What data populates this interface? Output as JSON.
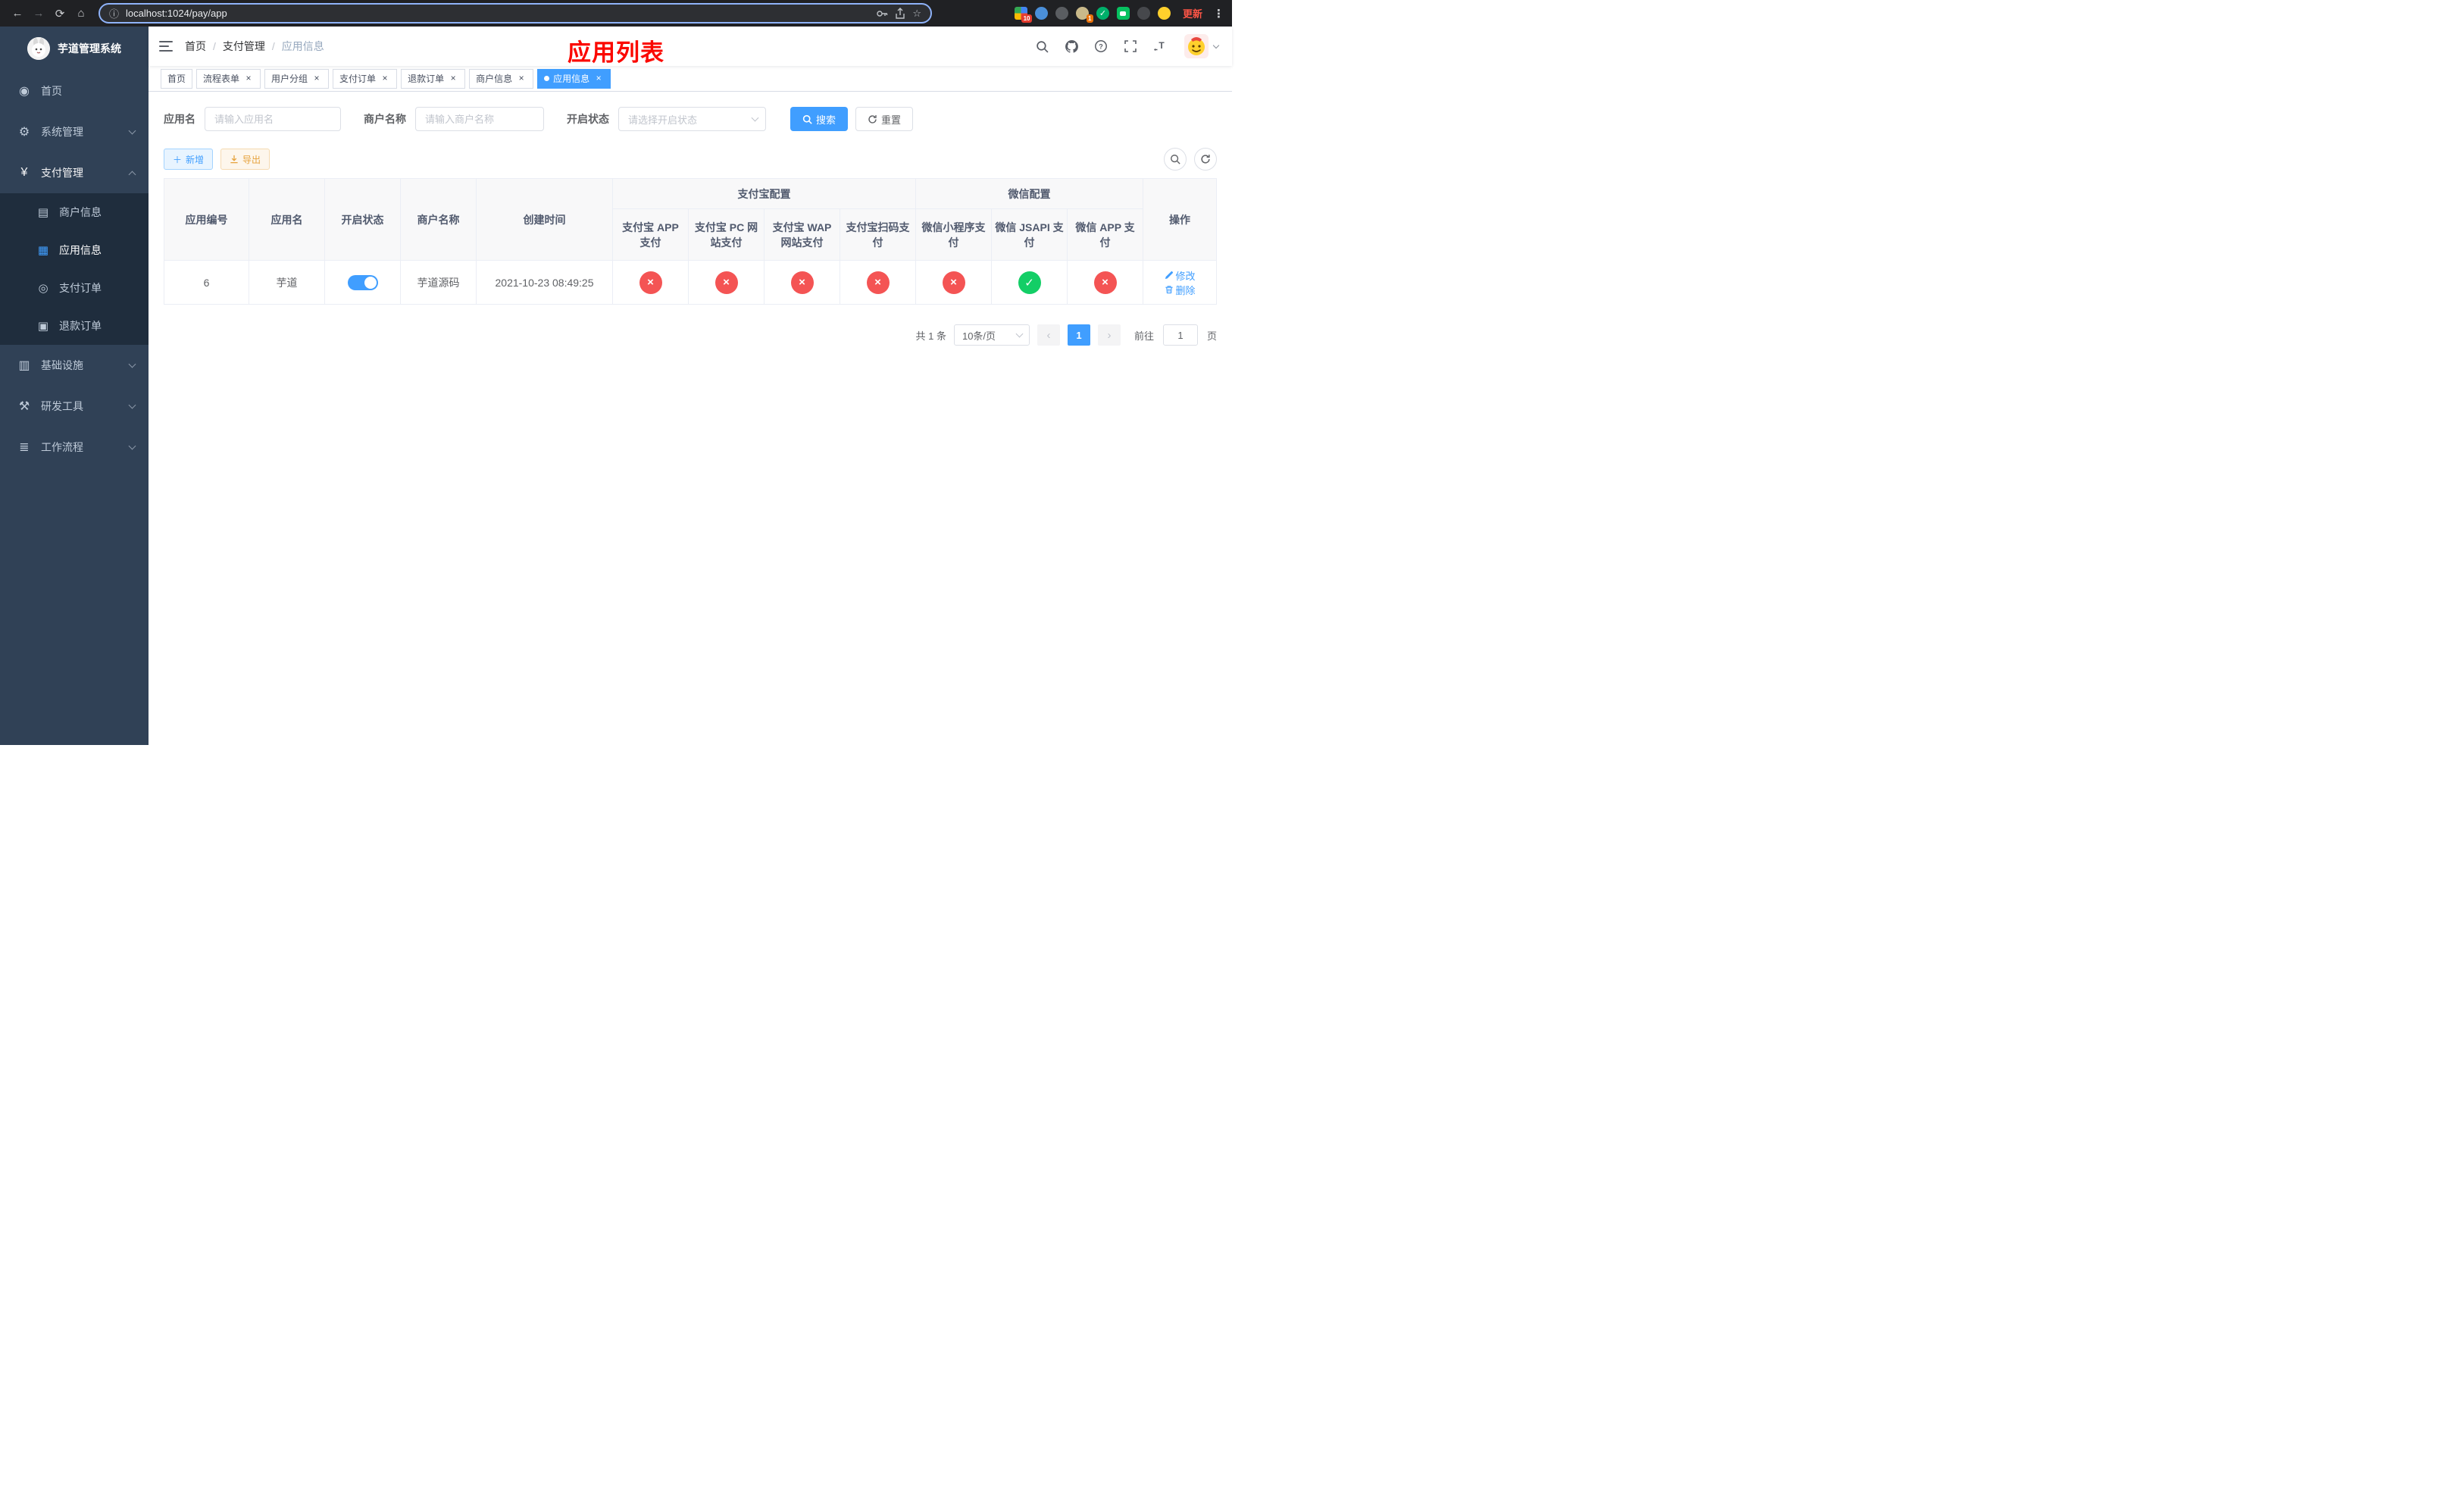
{
  "browser": {
    "url": "localhost:1024/pay/app",
    "update_label": "更新",
    "extension_badges": {
      "grid": "10",
      "person": "1"
    }
  },
  "sidebar": {
    "title": "芋道管理系统",
    "items": [
      {
        "label": "首页"
      },
      {
        "label": "系统管理"
      },
      {
        "label": "支付管理",
        "children": [
          {
            "label": "商户信息"
          },
          {
            "label": "应用信息"
          },
          {
            "label": "支付订单"
          },
          {
            "label": "退款订单"
          }
        ]
      },
      {
        "label": "基础设施"
      },
      {
        "label": "研发工具"
      },
      {
        "label": "工作流程"
      }
    ]
  },
  "header": {
    "breadcrumb": [
      "首页",
      "支付管理",
      "应用信息"
    ],
    "separator": "/",
    "overlay_title": "应用列表"
  },
  "tabs": [
    {
      "label": "首页"
    },
    {
      "label": "流程表单"
    },
    {
      "label": "用户分组"
    },
    {
      "label": "支付订单"
    },
    {
      "label": "退款订单"
    },
    {
      "label": "商户信息"
    },
    {
      "label": "应用信息"
    }
  ],
  "filters": {
    "app_name_label": "应用名",
    "app_name_placeholder": "请输入应用名",
    "merchant_label": "商户名称",
    "merchant_placeholder": "请输入商户名称",
    "status_label": "开启状态",
    "status_placeholder": "请选择开启状态",
    "search_label": "搜索",
    "reset_label": "重置"
  },
  "toolbar": {
    "add_label": "新增",
    "export_label": "导出"
  },
  "table": {
    "groups": {
      "alipay": "支付宝配置",
      "wechat": "微信配置"
    },
    "columns": {
      "id": "应用编号",
      "name": "应用名",
      "status": "开启状态",
      "merchant": "商户名称",
      "created": "创建时间",
      "alipay_app": "支付宝 APP 支付",
      "alipay_pc": "支付宝 PC 网站支付",
      "alipay_wap": "支付宝 WAP 网站支付",
      "alipay_qr": "支付宝扫码支付",
      "wx_lite": "微信小程序支付",
      "wx_jsapi": "微信 JSAPI 支付",
      "wx_app": "微信 APP 支付",
      "actions": "操作"
    },
    "rows": [
      {
        "id": "6",
        "name": "芋道",
        "enabled": true,
        "merchant": "芋道源码",
        "created": "2021-10-23 08:49:25",
        "configs": {
          "alipay_app": false,
          "alipay_pc": false,
          "alipay_wap": false,
          "alipay_qr": false,
          "wx_lite": false,
          "wx_jsapi": true,
          "wx_app": false
        },
        "edit_label": "修改",
        "delete_label": "删除"
      }
    ]
  },
  "pagination": {
    "total_text": "共 1 条",
    "page_size": "10条/页",
    "current_page": "1",
    "goto_label": "前往",
    "goto_value": "1",
    "goto_suffix": "页"
  },
  "colors": {
    "accent": "#409eff",
    "success": "#13ce66",
    "danger": "#f45454",
    "title_red": "#fb0800"
  }
}
